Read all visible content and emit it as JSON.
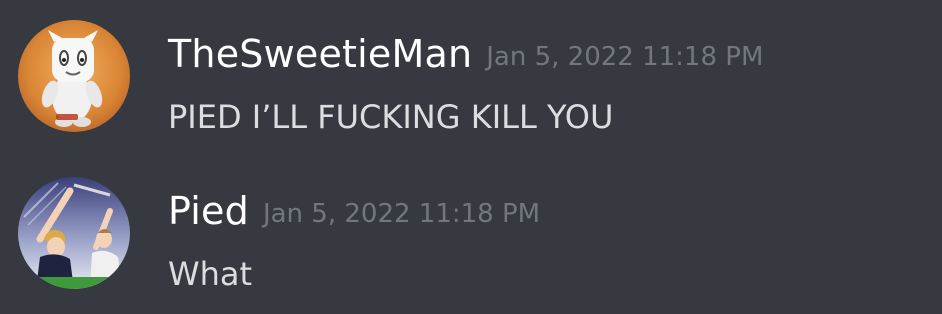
{
  "messages": [
    {
      "username": "TheSweetieMan",
      "timestamp": "Jan 5, 2022 11:18 PM",
      "text": "PIED I’LL FUCKING KILL YOU",
      "avatar_icon": "white-plush-character-avatar",
      "avatar_bg": "#d98535"
    },
    {
      "username": "Pied",
      "timestamp": "Jan 5, 2022 11:18 PM",
      "text": "What",
      "avatar_icon": "anime-characters-avatar",
      "avatar_bg": "#2a2d5a"
    }
  ],
  "colors": {
    "background": "#36393f",
    "username": "#ffffff",
    "timestamp": "#72767d",
    "message_text": "#dcddde"
  }
}
